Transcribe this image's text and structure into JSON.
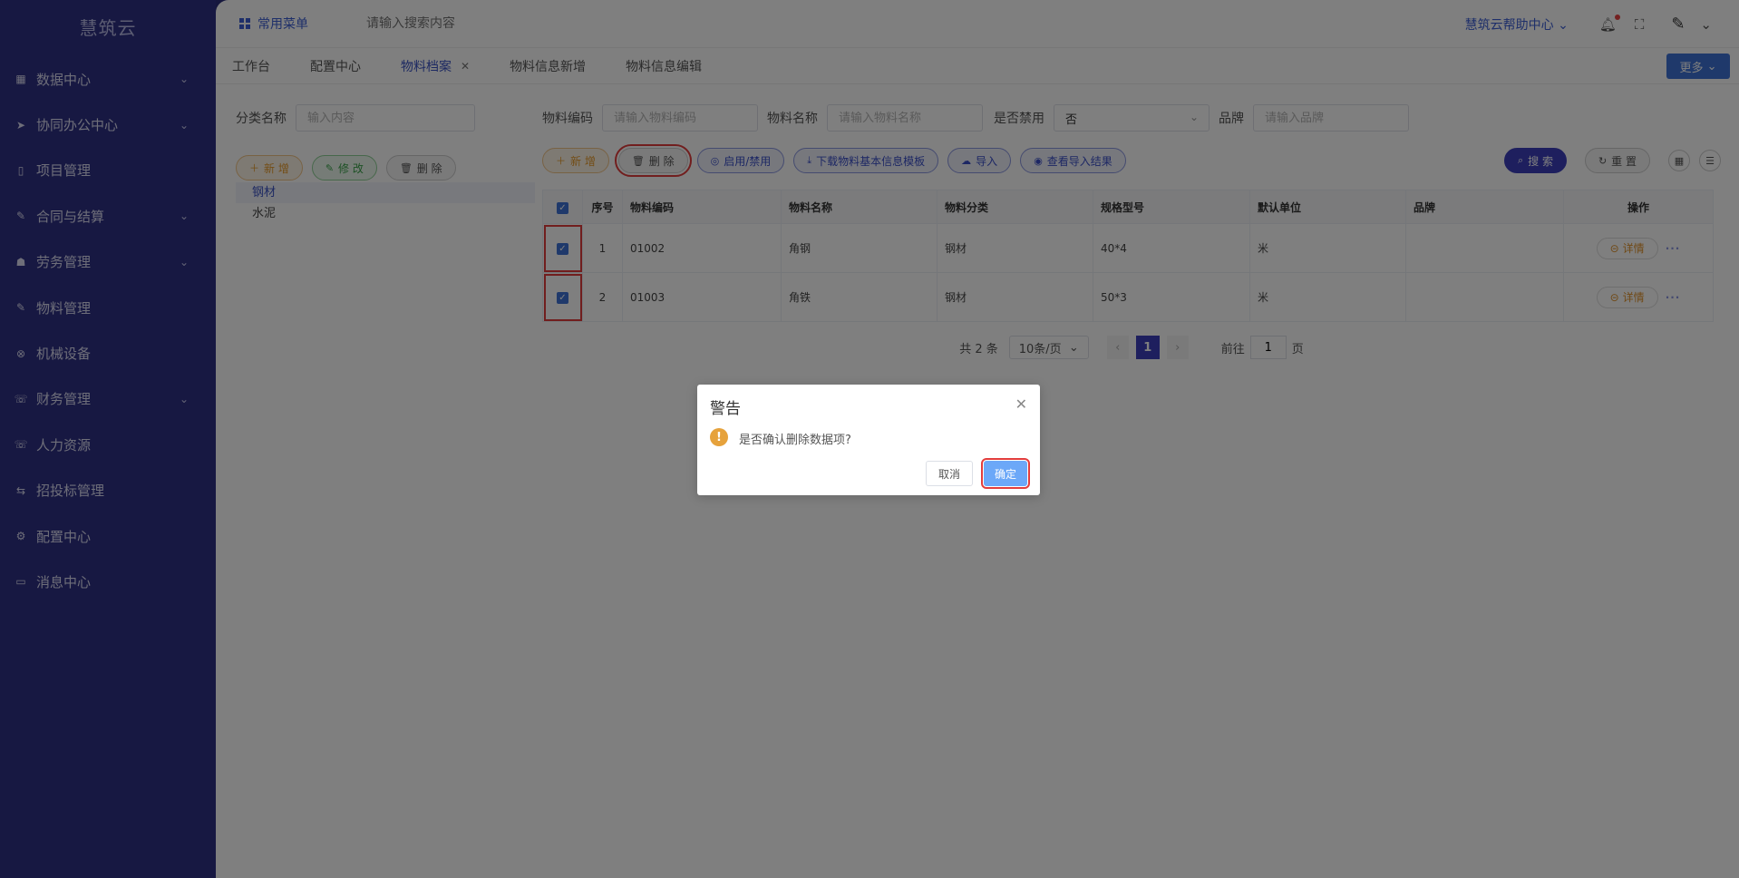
{
  "brand": "慧筑云",
  "sidebar": {
    "items": [
      {
        "label": "数据中心",
        "icon": "grid-icon",
        "has_children": true
      },
      {
        "label": "协同办公中心",
        "icon": "send-icon",
        "has_children": true
      },
      {
        "label": "项目管理",
        "icon": "book-icon",
        "has_children": false
      },
      {
        "label": "合同与结算",
        "icon": "edit-icon",
        "has_children": true
      },
      {
        "label": "劳务管理",
        "icon": "worker-icon",
        "has_children": true
      },
      {
        "label": "物料管理",
        "icon": "edit-icon",
        "has_children": false
      },
      {
        "label": "机械设备",
        "icon": "circle-x-icon",
        "has_children": false
      },
      {
        "label": "财务管理",
        "icon": "phone-icon",
        "has_children": true
      },
      {
        "label": "人力资源",
        "icon": "phone-icon",
        "has_children": false
      },
      {
        "label": "招投标管理",
        "icon": "sliders-icon",
        "has_children": false
      },
      {
        "label": "配置中心",
        "icon": "gear-icon",
        "has_children": false
      },
      {
        "label": "消息中心",
        "icon": "message-icon",
        "has_children": false
      }
    ]
  },
  "topbar": {
    "common_menu": "常用菜单",
    "search_placeholder": "请输入搜索内容",
    "help": "慧筑云帮助中心"
  },
  "tabs": [
    {
      "label": "工作台",
      "active": false,
      "closable": false
    },
    {
      "label": "配置中心",
      "active": false,
      "closable": false
    },
    {
      "label": "物料档案",
      "active": true,
      "closable": true
    },
    {
      "label": "物料信息新增",
      "active": false,
      "closable": false
    },
    {
      "label": "物料信息编辑",
      "active": false,
      "closable": false
    }
  ],
  "more_label": "更多",
  "left": {
    "category_label": "分类名称",
    "category_placeholder": "输入内容",
    "buttons": {
      "add": "新 增",
      "edit": "修 改",
      "delete": "删 除"
    },
    "tree": [
      "钢材",
      "水泥"
    ]
  },
  "filters": {
    "code_label": "物料编码",
    "code_placeholder": "请输入物料编码",
    "name_label": "物料名称",
    "name_placeholder": "请输入物料名称",
    "disabled_label": "是否禁用",
    "disabled_value": "否",
    "brand_label": "品牌",
    "brand_placeholder": "请输入品牌"
  },
  "actions": {
    "add": "新 增",
    "delete": "删 除",
    "toggle": "启用/禁用",
    "download": "下载物料基本信息模板",
    "import": "导入",
    "view_import": "查看导入结果",
    "search": "搜 索",
    "reset": "重 置"
  },
  "table": {
    "headers": [
      "序号",
      "物料编码",
      "物料名称",
      "物料分类",
      "规格型号",
      "默认单位",
      "品牌",
      "操作"
    ],
    "rows": [
      {
        "index": "1",
        "code": "01002",
        "name": "角钢",
        "category": "钢材",
        "spec": "40*4",
        "unit": "米",
        "brand": "",
        "action": "详情"
      },
      {
        "index": "2",
        "code": "01003",
        "name": "角铁",
        "category": "钢材",
        "spec": "50*3",
        "unit": "米",
        "brand": "",
        "action": "详情"
      }
    ]
  },
  "pager": {
    "total": "共 2 条",
    "page_size": "10条/页",
    "current": "1",
    "goto_prefix": "前往",
    "goto_value": "1",
    "goto_suffix": "页"
  },
  "dialog": {
    "title": "警告",
    "message": "是否确认删除数据项?",
    "cancel": "取消",
    "confirm": "确定"
  }
}
